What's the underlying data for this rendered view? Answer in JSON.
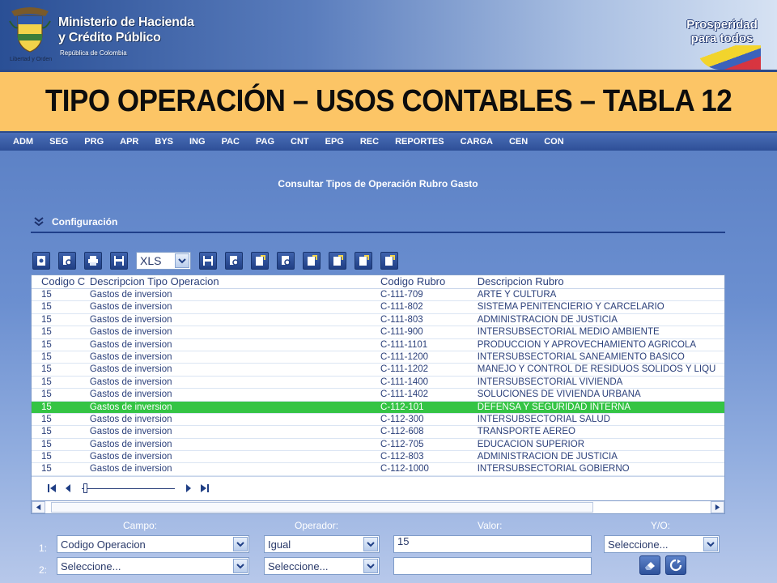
{
  "banner": {
    "ministry_line1": "Ministerio de Hacienda",
    "ministry_line2": "y Crédito Público",
    "ministry_sub": "República de Colombia",
    "crest_caption": "Libertad y Orden",
    "prosperidad_line1": "Prosperidad",
    "prosperidad_line2": "para todos"
  },
  "slide_title": "TIPO OPERACIÓN – USOS CONTABLES – TABLA 12",
  "nav": [
    "ADM",
    "SEG",
    "PRG",
    "APR",
    "BYS",
    "ING",
    "PAC",
    "PAG",
    "CNT",
    "EPG",
    "REC",
    "REPORTES",
    "CARGA",
    "CEN",
    "CON"
  ],
  "page_heading": "Consultar Tipos de Operación Rubro Gasto",
  "section": {
    "title": "Configuración"
  },
  "toolbar": {
    "export_format": "XLS"
  },
  "grid": {
    "headers": [
      "Codigo C",
      "Descripcion Tipo Operacion",
      "Codigo Rubro",
      "Descripcion Rubro"
    ],
    "rows": [
      [
        "15",
        "Gastos de inversion",
        "C-111-709",
        "ARTE Y CULTURA"
      ],
      [
        "15",
        "Gastos de inversion",
        "C-111-802",
        "SISTEMA PENITENCIERIO Y CARCELARIO"
      ],
      [
        "15",
        "Gastos de inversion",
        "C-111-803",
        "ADMINISTRACION DE JUSTICIA"
      ],
      [
        "15",
        "Gastos de inversion",
        "C-111-900",
        "INTERSUBSECTORIAL MEDIO AMBIENTE"
      ],
      [
        "15",
        "Gastos de inversion",
        "C-111-1101",
        "PRODUCCION Y APROVECHAMIENTO AGRICOLA"
      ],
      [
        "15",
        "Gastos de inversion",
        "C-111-1200",
        "INTERSUBSECTORIAL SANEAMIENTO BASICO"
      ],
      [
        "15",
        "Gastos de inversion",
        "C-111-1202",
        "MANEJO Y CONTROL DE RESIDUOS SOLIDOS Y LIQU"
      ],
      [
        "15",
        "Gastos de inversion",
        "C-111-1400",
        "INTERSUBSECTORIAL VIVIENDA"
      ],
      [
        "15",
        "Gastos de inversion",
        "C-111-1402",
        "SOLUCIONES DE VIVIENDA URBANA"
      ],
      [
        "15",
        "Gastos de inversion",
        "C-112-101",
        "DEFENSA Y SEGURIDAD INTERNA"
      ],
      [
        "15",
        "Gastos de inversion",
        "C-112-300",
        "INTERSUBSECTORIAL SALUD"
      ],
      [
        "15",
        "Gastos de inversion",
        "C-112-608",
        "TRANSPORTE AEREO"
      ],
      [
        "15",
        "Gastos de inversion",
        "C-112-705",
        "EDUCACION SUPERIOR"
      ],
      [
        "15",
        "Gastos de inversion",
        "C-112-803",
        "ADMINISTRACION DE JUSTICIA"
      ],
      [
        "15",
        "Gastos de inversion",
        "C-112-1000",
        "INTERSUBSECTORIAL GOBIERNO"
      ]
    ],
    "selected_row": 9
  },
  "filters": {
    "labels": {
      "campo": "Campo:",
      "operador": "Operador:",
      "valor": "Valor:",
      "yo": "Y/O:"
    },
    "rows": [
      {
        "num": "1:",
        "campo": "Codigo Operacion",
        "operador": "Igual",
        "valor": "15",
        "yo": "Seleccione..."
      },
      {
        "num": "2:",
        "campo": "Seleccione...",
        "operador": "Seleccione...",
        "valor": ""
      }
    ]
  },
  "colors": {
    "selected_row": "#34c444",
    "title_bar": "#fcc566",
    "nav": "#2e4f97"
  }
}
